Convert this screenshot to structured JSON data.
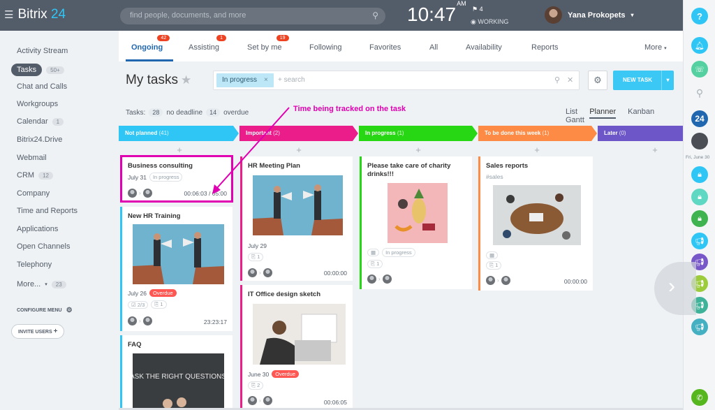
{
  "header": {
    "logo_text": "Bitrix",
    "logo_num": "24",
    "search_placeholder": "find people, documents, and more",
    "clock": "10:47",
    "ampm": "AM",
    "flag_count": "4",
    "work_status": "WORKING",
    "user_name": "Yana Prokopets"
  },
  "sidebar": {
    "items": [
      {
        "label": "Activity Stream"
      },
      {
        "label": "Tasks",
        "count": "50+"
      },
      {
        "label": "Chat and Calls"
      },
      {
        "label": "Workgroups"
      },
      {
        "label": "Calendar",
        "count": "1"
      },
      {
        "label": "Bitrix24.Drive"
      },
      {
        "label": "Webmail"
      },
      {
        "label": "CRM",
        "count": "12"
      },
      {
        "label": "Company"
      },
      {
        "label": "Time and Reports"
      },
      {
        "label": "Applications"
      },
      {
        "label": "Open Channels"
      },
      {
        "label": "Telephony"
      },
      {
        "label": "More...",
        "count": "23"
      }
    ],
    "configure": "CONFIGURE MENU",
    "invite": "INVITE USERS"
  },
  "tabs": [
    {
      "label": "Ongoing",
      "badge": "42"
    },
    {
      "label": "Assisting",
      "badge": "1"
    },
    {
      "label": "Set by me",
      "badge": "19"
    },
    {
      "label": "Following"
    },
    {
      "label": "Favorites"
    },
    {
      "label": "All"
    },
    {
      "label": "Availability"
    },
    {
      "label": "Reports"
    },
    {
      "label": "More"
    }
  ],
  "page": {
    "title": "My tasks",
    "filter_chip": "In progress",
    "filter_placeholder": "+ search",
    "new_task": "NEW TASK",
    "tasks_label": "Tasks:",
    "no_deadline_count": "28",
    "no_deadline_label": "no deadline",
    "overdue_count": "14",
    "overdue_label": "overdue",
    "views": [
      "List",
      "Planner",
      "Kanban",
      "Gantt"
    ],
    "annotation": "Time being tracked on the task",
    "side_date": "Fri, June 30"
  },
  "columns": [
    {
      "title": "Not planned",
      "count": "(41)",
      "color": "#2fc6f6"
    },
    {
      "title": "Important",
      "count": "(2)",
      "color": "#ea1d8b"
    },
    {
      "title": "In progress",
      "count": "(1)",
      "color": "#28d714"
    },
    {
      "title": "To be done this week",
      "count": "(1)",
      "color": "#fd8a45"
    },
    {
      "title": "Later",
      "count": "(0)",
      "color": "#6c56c8"
    }
  ],
  "cards": {
    "c1": {
      "title": "Business consulting",
      "date": "July 31",
      "status": "In progress",
      "time": "00:06:03 / 05:00"
    },
    "c2": {
      "title": "New HR Training",
      "date": "July 26",
      "overdue": "Overdue",
      "checklist": "2/3",
      "files": "1",
      "time": "23:23:17"
    },
    "c3": {
      "title": "FAQ",
      "img_text": "ASK THE RIGHT QUESTIONS"
    },
    "c4": {
      "title": "HR Meeting Plan",
      "date": "July 29",
      "files": "1",
      "time": "00:00:00"
    },
    "c5": {
      "title": "IT Office design sketch",
      "date": "June 30",
      "overdue": "Overdue",
      "files": "2",
      "time": "00:06:05"
    },
    "c6": {
      "title": "Please take care of charity drinks!!!",
      "status": "In progress",
      "files": "1"
    },
    "c7": {
      "title": "Sales reports",
      "hashtag": "#sales",
      "files": "1",
      "time": "00:00:00"
    }
  },
  "colors": {
    "accent": "#2067b0",
    "topbar": "#535c69",
    "new_task": "#3bc8f5",
    "annotation": "#e000b2"
  }
}
